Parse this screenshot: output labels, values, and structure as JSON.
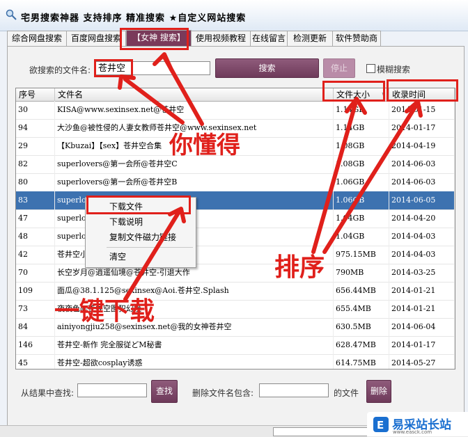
{
  "window": {
    "title": "宅男搜索神器  支持排序 精准搜索 ★自定义网站搜索"
  },
  "tabs": [
    "综合网盘搜索",
    "百度网盘搜索",
    "【女神 搜索】",
    "使用视频教程",
    "在线留言",
    "检测更新",
    "软件赞助商"
  ],
  "search": {
    "label": "欲搜索的文件名:",
    "value": "苍井空",
    "search_button": "搜索",
    "stop_button": "停止",
    "fuzzy_label": "模糊搜索"
  },
  "table": {
    "headers": [
      "序号",
      "文件名",
      "文件大小",
      "收录时间"
    ],
    "rows": [
      {
        "no": "30",
        "name": "KISA@www.sexinsex.net@苍井空",
        "size": "1.14GB",
        "date": "2014-01-15"
      },
      {
        "no": "94",
        "name": "大沙鱼@被性侵的人妻女教师苍井空@www.sexinsex.net",
        "size": "1.14GB",
        "date": "2014-01-17"
      },
      {
        "no": "29",
        "name": "【Kbuzai】【sex】苍井空合集",
        "size": "1.08GB",
        "date": "2014-04-19"
      },
      {
        "no": "82",
        "name": "superlovers@第一会所@苍井空C",
        "size": "1.08GB",
        "date": "2014-06-03"
      },
      {
        "no": "80",
        "name": "superlovers@第一会所@苍井空B",
        "size": "1.06GB",
        "date": "2014-06-03"
      },
      {
        "no": "83",
        "name": "superlovers@第一会所@苍井空A",
        "size": "1.06GB",
        "date": "2014-06-05"
      },
      {
        "no": "47",
        "name": "superlovers@第一会所@苍井空",
        "size": "1.04GB",
        "date": "2014-04-20"
      },
      {
        "no": "48",
        "name": "superlovers@第一会所@苍井空",
        "size": "1.04GB",
        "date": "2014-04-03"
      },
      {
        "no": "42",
        "name": "苍井空小",
        "size": "975.15MB",
        "date": "2014-04-03"
      },
      {
        "no": "70",
        "name": "长空岁月@逍遥仙境@苍井空-引退大作",
        "size": "790MB",
        "date": "2014-03-25"
      },
      {
        "no": "109",
        "name": "面瓜@38.1.125@sexinsex@Aoi.苍井空.Splash",
        "size": "656.44MB",
        "date": "2014-01-21"
      },
      {
        "no": "73",
        "name": "夜夜色@苍井空图犯幻境",
        "size": "655.4MB",
        "date": "2014-01-21"
      },
      {
        "no": "84",
        "name": "ainiyongjiu258@sexinsex.net@我的女神苍井空",
        "size": "630.5MB",
        "date": "2014-06-04"
      },
      {
        "no": "146",
        "name": "苍井空-新作 完全服従どM秘書",
        "size": "628.47MB",
        "date": "2014-01-17"
      },
      {
        "no": "45",
        "name": "苍井空-超欲cosplay诱惑",
        "size": "614.75MB",
        "date": "2014-05-27"
      }
    ]
  },
  "context_menu": [
    "下载文件",
    "下载说明",
    "复制文件磁力链接",
    "清空"
  ],
  "bottom": {
    "find_label": "从结果中查找:",
    "find_button": "查找",
    "delete_label": "删除文件名包含:",
    "delete_suffix": "的文件",
    "delete_button": "删除"
  },
  "annotations": {
    "understand": "你懂得",
    "sort": "排序",
    "one_click": "一键下载"
  },
  "watermark": {
    "text": "易采站长站",
    "sub": "www.easck.com"
  },
  "colors": {
    "accent": "#7a3a5a",
    "highlight": "#e0201b",
    "selection": "#3d72b0"
  }
}
